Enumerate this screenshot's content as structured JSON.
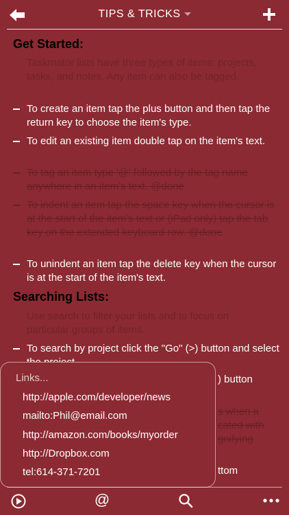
{
  "header": {
    "title": "TIPS & TRICKS"
  },
  "sections": [
    {
      "heading": "Get Started:",
      "note": "Taskmator lists have three types of items: projects, tasks, and notes. Any item can also be tagged.",
      "tasks": [
        {
          "text": "To create an item tap the plus button and then tap the return key to choose the item's type.",
          "done": false
        },
        {
          "text": "To edit an existing item double tap on the item's text.",
          "done": false
        },
        {
          "text": "To tag an item type '@' followed by the tag name anywhere in an item's text. @done",
          "done": true
        },
        {
          "text": "To indent an item tap the space key when the cursor is at the start of the item's text or (iPad only) tap the tab key on the extended keyboard row. @done",
          "done": true
        },
        {
          "text": "To unindent an item tap the delete key when the cursor is at the start of the item's text.",
          "done": false
        }
      ]
    },
    {
      "heading": "Searching Lists:",
      "note": "Use search to filter your lists and to focus on particular groups of items.",
      "tasks": [
        {
          "text": "To search by project click the \"Go\" (>) button and select the project.",
          "done": false
        }
      ]
    }
  ],
  "hidden_fragments": {
    "button_tail": ") button",
    "strike_1": "s when a",
    "strike_2": "cated with",
    "strike_3": "gnifying",
    "bottom_tail": "ttom"
  },
  "popup": {
    "title": "Links...",
    "links": [
      "http://apple.com/developer/news",
      "mailto:Phil@email.com",
      "http://amazon.com/books/myorder",
      "http://Dropbox.com",
      "tel:614-371-7201"
    ]
  },
  "footer": {
    "at_symbol": "@"
  },
  "colors": {
    "background": "#8b2a32",
    "heading": "#000000",
    "text": "#ffffff"
  }
}
